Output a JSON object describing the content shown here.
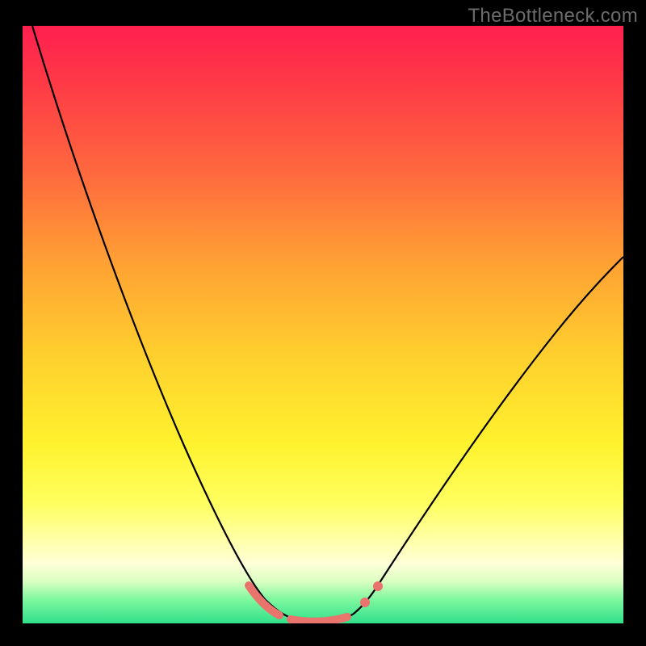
{
  "attribution": "TheBottleneck.com",
  "colors": {
    "frame": "#000000",
    "gradient_top": "#ff1f4f",
    "gradient_bottom": "#2fe18a",
    "curve": "#000000",
    "bead": "#e8746d",
    "attribution_text": "#6b6b6b"
  },
  "chart_data": {
    "type": "line",
    "title": "",
    "xlabel": "",
    "ylabel": "",
    "xlim": [
      0,
      100
    ],
    "ylim": [
      0,
      100
    ],
    "grid": false,
    "legend": false,
    "series": [
      {
        "name": "bottleneck-curve",
        "x": [
          0,
          5,
          10,
          15,
          20,
          25,
          30,
          35,
          40,
          42,
          45,
          48,
          50,
          52,
          55,
          60,
          65,
          70,
          75,
          80,
          85,
          90,
          95,
          100
        ],
        "y": [
          100,
          91,
          82,
          72,
          62,
          52,
          41,
          30,
          17,
          11,
          4,
          1,
          0,
          0,
          1,
          5,
          12,
          20,
          28,
          35,
          42,
          48,
          54,
          59
        ]
      }
    ],
    "annotations": [
      {
        "type": "marker-segment",
        "x_start": 37,
        "x_end": 43
      },
      {
        "type": "marker-segment",
        "x_start": 45,
        "x_end": 55
      },
      {
        "type": "marker-point",
        "x": 57
      },
      {
        "type": "marker-point",
        "x": 59
      }
    ]
  }
}
